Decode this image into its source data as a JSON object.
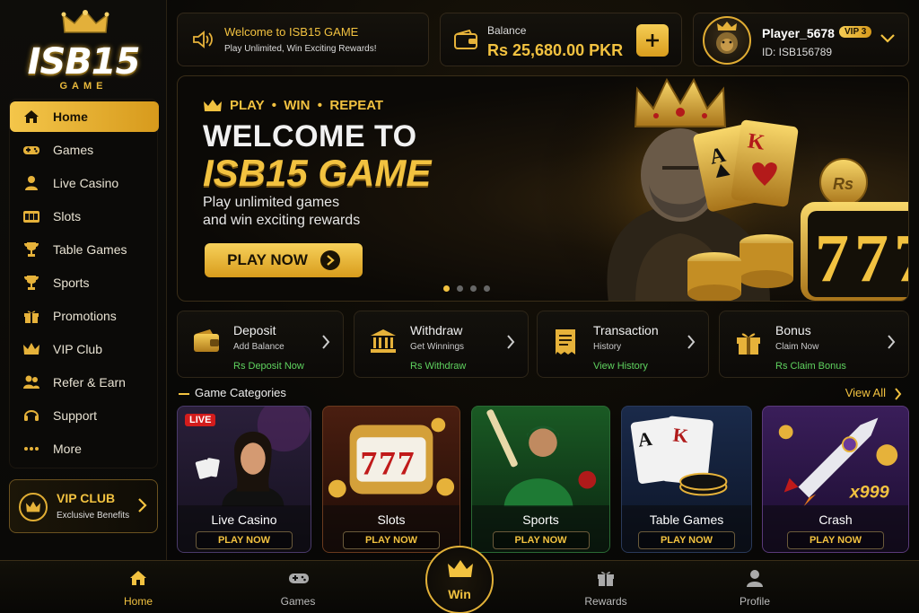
{
  "logo": {
    "brand": "ISB15",
    "sub": "GAME"
  },
  "sidebar": {
    "items": [
      {
        "label": "Home",
        "icon": "home-icon"
      },
      {
        "label": "Games",
        "icon": "gamepad-icon"
      },
      {
        "label": "Live Casino",
        "icon": "dealer-icon"
      },
      {
        "label": "Slots",
        "icon": "slots-icon"
      },
      {
        "label": "Table Games",
        "icon": "trophy-icon"
      },
      {
        "label": "Sports",
        "icon": "trophy-icon"
      },
      {
        "label": "Promotions",
        "icon": "gift-icon"
      },
      {
        "label": "VIP Club",
        "icon": "crown-icon"
      },
      {
        "label": "Refer & Earn",
        "icon": "users-icon"
      },
      {
        "label": "Support",
        "icon": "headset-icon"
      },
      {
        "label": "More",
        "icon": "more-icon"
      }
    ],
    "vip": {
      "title": "VIP CLUB",
      "subtitle": "Exclusive Benefits"
    }
  },
  "header": {
    "welcome_title": "Welcome to ISB15 GAME",
    "welcome_sub": "Play Unlimited, Win Exciting Rewards!",
    "balance_label": "Balance",
    "balance_value": "Rs 25,680.00 PKR",
    "player_name": "Player_5678",
    "vip_level": "VIP 3",
    "player_id": "ID: ISB156789"
  },
  "hero": {
    "tagline": "PLAY  •  WIN  •  REPEAT",
    "title_line1": "WELCOME TO",
    "title_line2": "ISB15 GAME",
    "desc_line1": "Play unlimited games",
    "desc_line2": "and win exciting rewards",
    "cta": "PLAY NOW",
    "slot_digits": "777",
    "coin_label": "Rs",
    "card1": "A",
    "card2": "K"
  },
  "quick_actions": [
    {
      "title": "Deposit",
      "sub": "Add Balance",
      "link": "Rs Deposit Now",
      "icon": "wallet-icon"
    },
    {
      "title": "Withdraw",
      "sub": "Get Winnings",
      "link": "Rs Withdraw",
      "icon": "bank-icon"
    },
    {
      "title": "Transaction",
      "sub": "History",
      "link": "View History",
      "icon": "receipt-icon"
    },
    {
      "title": "Bonus",
      "sub": "Claim Now",
      "link": "Rs Claim Bonus",
      "icon": "gift-icon"
    }
  ],
  "categories": {
    "title": "Game Categories",
    "view_all": "View All",
    "items": [
      {
        "name": "Live Casino",
        "cta": "PLAY NOW",
        "badge": "LIVE"
      },
      {
        "name": "Slots",
        "cta": "PLAY NOW",
        "digits": "777"
      },
      {
        "name": "Sports",
        "cta": "PLAY NOW"
      },
      {
        "name": "Table Games",
        "cta": "PLAY NOW",
        "card1": "A",
        "card2": "K"
      },
      {
        "name": "Crash",
        "cta": "PLAY NOW",
        "multiplier": "x999"
      }
    ]
  },
  "bottom_nav": [
    {
      "label": "Home",
      "icon": "home-icon"
    },
    {
      "label": "Games",
      "icon": "gamepad-icon"
    },
    {
      "label": "Win",
      "icon": "crown-icon"
    },
    {
      "label": "Rewards",
      "icon": "gift-icon"
    },
    {
      "label": "Profile",
      "icon": "user-icon"
    }
  ],
  "colors": {
    "accent": "#f2c240",
    "success": "#5fd35f",
    "live": "#d31c1c",
    "background": "#070707"
  }
}
